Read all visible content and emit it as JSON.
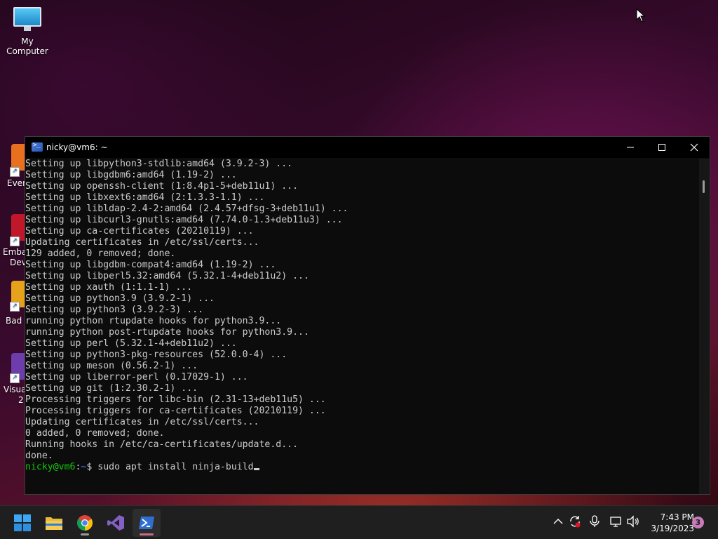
{
  "desktop": {
    "icons": [
      {
        "label": "My Computer"
      }
    ],
    "side_icons": [
      {
        "label_line1": "Even"
      },
      {
        "label_line1": "Emba",
        "label_line2": "Dev"
      },
      {
        "label_line1": "Bad F"
      },
      {
        "label_line1": "Visual",
        "label_line2": "2"
      }
    ]
  },
  "terminal": {
    "title": "nicky@vm6: ~",
    "lines": [
      "Setting up libpython3-stdlib:amd64 (3.9.2-3) ...",
      "Setting up libgdbm6:amd64 (1.19-2) ...",
      "Setting up openssh-client (1:8.4p1-5+deb11u1) ...",
      "Setting up libxext6:amd64 (2:1.3.3-1.1) ...",
      "Setting up libldap-2.4-2:amd64 (2.4.57+dfsg-3+deb11u1) ...",
      "Setting up libcurl3-gnutls:amd64 (7.74.0-1.3+deb11u3) ...",
      "Setting up ca-certificates (20210119) ...",
      "Updating certificates in /etc/ssl/certs...",
      "129 added, 0 removed; done.",
      "Setting up libgdbm-compat4:amd64 (1.19-2) ...",
      "Setting up libperl5.32:amd64 (5.32.1-4+deb11u2) ...",
      "Setting up xauth (1:1.1-1) ...",
      "Setting up python3.9 (3.9.2-1) ...",
      "Setting up python3 (3.9.2-3) ...",
      "running python rtupdate hooks for python3.9...",
      "running python post-rtupdate hooks for python3.9...",
      "Setting up perl (5.32.1-4+deb11u2) ...",
      "Setting up python3-pkg-resources (52.0.0-4) ...",
      "Setting up meson (0.56.2-1) ...",
      "Setting up liberror-perl (0.17029-1) ...",
      "Setting up git (1:2.30.2-1) ...",
      "Processing triggers for libc-bin (2.31-13+deb11u5) ...",
      "Processing triggers for ca-certificates (20210119) ...",
      "Updating certificates in /etc/ssl/certs...",
      "0 added, 0 removed; done.",
      "Running hooks in /etc/ca-certificates/update.d...",
      "done."
    ],
    "prompt": {
      "user_host": "nicky@vm6",
      "sep": ":",
      "path": "~",
      "symbol": "$ ",
      "command": "sudo apt install ninja-build"
    },
    "colors": {
      "background": "#0c0c0c",
      "text": "#cccccc",
      "prompt_user": "#16c60c",
      "prompt_path": "#3b78ff"
    }
  },
  "taskbar": {
    "apps": [
      {
        "name": "start-button"
      },
      {
        "name": "file-explorer"
      },
      {
        "name": "google-chrome"
      },
      {
        "name": "visual-studio"
      },
      {
        "name": "terminal",
        "active": true
      }
    ],
    "clock": {
      "time": "7:43 PM",
      "date": "3/19/2023"
    },
    "notification_count": "3"
  }
}
